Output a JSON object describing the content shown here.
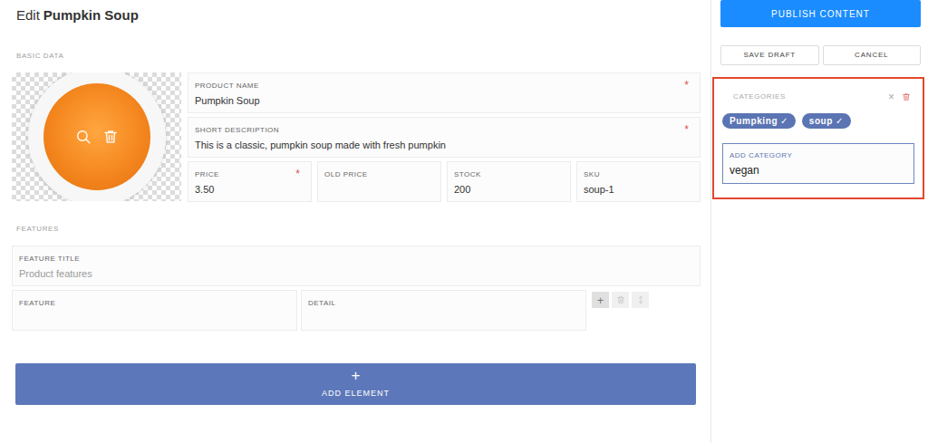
{
  "page": {
    "title_prefix": "Edit",
    "title_name": "Pumpkin Soup"
  },
  "actions": {
    "publish": "PUBLISH CONTENT",
    "save_draft": "SAVE DRAFT",
    "cancel": "CANCEL"
  },
  "basic_data": {
    "label": "BASIC DATA",
    "rows": [
      [
        {
          "label": "PRODUCT NAME",
          "value": "Pumpkin Soup",
          "required": true,
          "required_mark": "*"
        }
      ],
      [
        {
          "label": "SHORT DESCRIPTION",
          "value": "This is a classic, pumpkin soup made with fresh pumpkin",
          "required": true,
          "required_mark": "*"
        }
      ],
      [
        {
          "label": "PRICE",
          "value": "3.50",
          "required": true,
          "required_mark": "*"
        },
        {
          "label": "OLD PRICE",
          "value": "",
          "required": false
        },
        {
          "label": "STOCK",
          "value": "200",
          "required": false
        },
        {
          "label": "SKU",
          "value": "soup-1",
          "required": false
        }
      ]
    ]
  },
  "features": {
    "label": "FEATURES",
    "title_field": {
      "label": "FEATURE TITLE",
      "placeholder": "Product features"
    },
    "rows": [
      {
        "feature": {
          "label": "FEATURE",
          "value": ""
        },
        "detail": {
          "label": "DETAIL",
          "value": ""
        }
      }
    ],
    "row_buttons": [
      {
        "kind": "add",
        "glyph": "+",
        "disabled": false
      },
      {
        "kind": "delete",
        "disabled": true
      },
      {
        "kind": "move",
        "disabled": true
      }
    ]
  },
  "add_element": {
    "glyph": "+",
    "label": "ADD ELEMENT"
  },
  "categories": {
    "label": "CATEGORIES",
    "close_glyph": "×",
    "tags": [
      {
        "label": "Pumpking",
        "check": "✓"
      },
      {
        "label": "soup",
        "check": "✓"
      }
    ],
    "input": {
      "label": "ADD CATEGORY",
      "value": "vegan"
    }
  }
}
